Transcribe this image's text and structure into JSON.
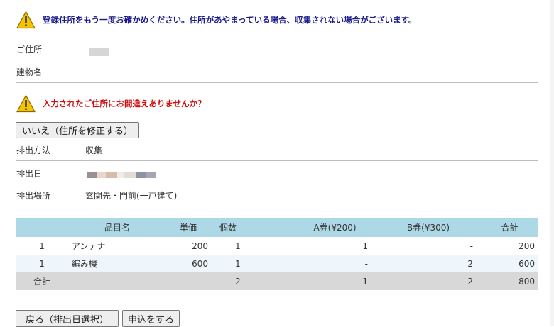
{
  "warning_top": {
    "icon": "warning-icon",
    "text": "登録住所をもう一度お確かめください。住所があやまっている場合、収集されない場合がございます。"
  },
  "address": {
    "label_address": "ご住所",
    "label_building": "建物名",
    "building_value": ""
  },
  "confirm_warning": {
    "icon": "warning-icon",
    "text": "入力されたご住所にお間違えありませんか？"
  },
  "fix_button": "いいえ（住所を修正する）",
  "details": {
    "method_label": "排出方法",
    "method_value": "収集",
    "date_label": "排出日",
    "place_label": "排出場所",
    "place_value": "玄関先・門前(一戸建て)"
  },
  "table": {
    "headers": [
      "",
      "品目名",
      "単価",
      "個数",
      "A券(¥200)",
      "B券(¥300)",
      "合計"
    ],
    "rows": [
      [
        "1",
        "アンテナ",
        "200",
        "1",
        "1",
        "-",
        "200"
      ],
      [
        "1",
        "編み機",
        "600",
        "1",
        "-",
        "2",
        "600"
      ]
    ],
    "total": [
      "合計",
      "",
      "",
      "2",
      "1",
      "2",
      "800"
    ]
  },
  "buttons": {
    "back": "戻る（排出日選択）",
    "apply": "申込をする"
  },
  "colors": {
    "table_header": "#add8e6",
    "warn_blue": "#1a1a8c",
    "warn_red": "#d01010"
  }
}
